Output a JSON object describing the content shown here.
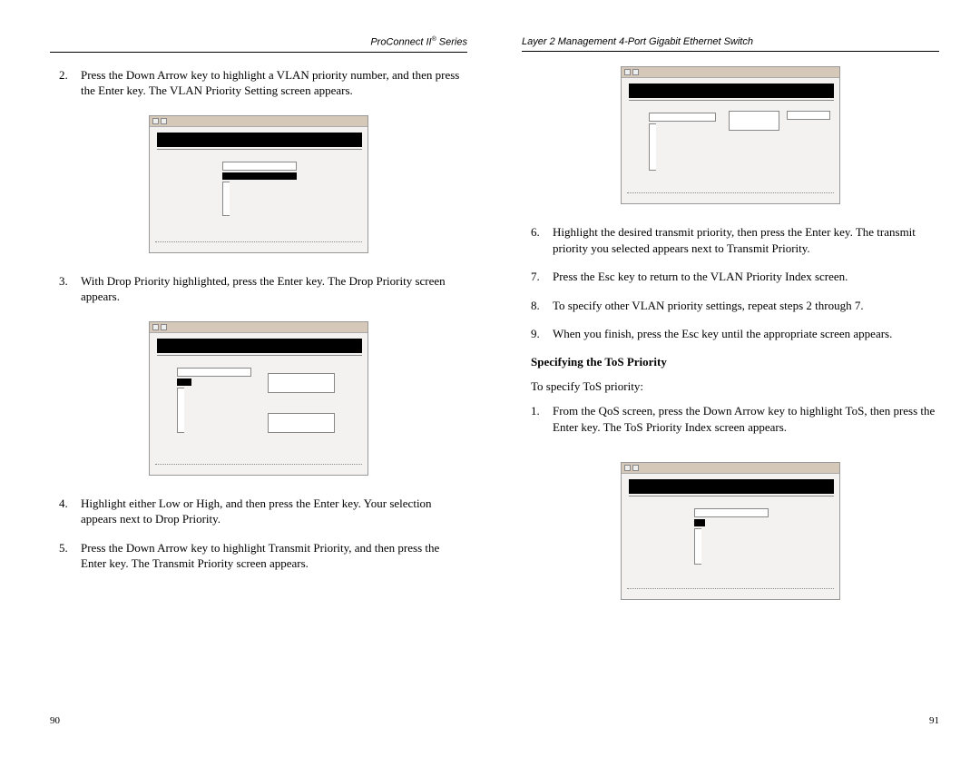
{
  "left": {
    "header_a": "ProConnect II",
    "header_b": " Series",
    "page_num": "90",
    "items": {
      "2": "Press the Down Arrow key to highlight a VLAN priority number, and then press the Enter key. The VLAN Priority Setting screen appears.",
      "3": "With Drop Priority highlighted, press the Enter key. The Drop Priority screen appears.",
      "4": "Highlight either Low or High, and then press the Enter key. Your selection appears next to Drop Priority.",
      "5": "Press the Down Arrow key to highlight Transmit Priority, and then press the Enter key. The Transmit Priority screen appears."
    }
  },
  "right": {
    "header": "Layer 2 Management 4-Port Gigabit Ethernet Switch",
    "page_num": "91",
    "items": {
      "6": "Highlight the desired transmit priority, then press the Enter key. The transmit priority you selected appears next to Transmit Priority.",
      "7": "Press the Esc key to return to the VLAN Priority Index screen.",
      "8": "To specify other VLAN priority settings, repeat steps 2 through 7.",
      "9": "When you finish, press the Esc key until the appropriate screen appears."
    },
    "section_heading": "Specifying the ToS Priority",
    "section_intro": "To specify ToS priority:",
    "sec_items": {
      "1": "From the QoS screen, press the Down Arrow key to highlight ToS, then press the Enter key. The ToS Priority Index screen appears."
    }
  }
}
